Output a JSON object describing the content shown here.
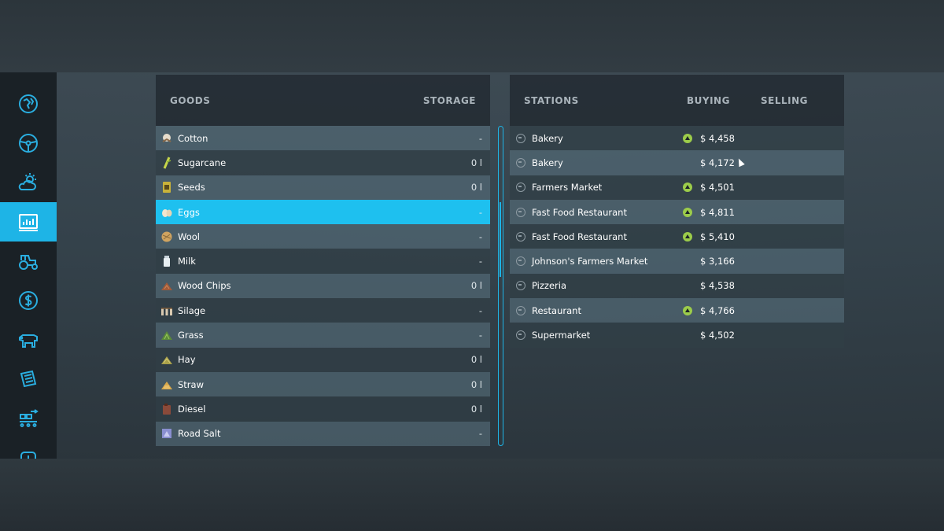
{
  "sidebar": {
    "items": [
      {
        "name": "map-icon",
        "active": false
      },
      {
        "name": "steering-wheel-icon",
        "active": false
      },
      {
        "name": "weather-icon",
        "active": false
      },
      {
        "name": "prices-chart-icon",
        "active": true
      },
      {
        "name": "tractor-icon",
        "active": false
      },
      {
        "name": "dollar-icon",
        "active": false
      },
      {
        "name": "cow-icon",
        "active": false
      },
      {
        "name": "contracts-icon",
        "active": false
      },
      {
        "name": "production-icon",
        "active": false
      },
      {
        "name": "help-icon",
        "active": false
      }
    ]
  },
  "goods": {
    "header_goods": "GOODS",
    "header_storage": "STORAGE",
    "items": [
      {
        "label": "Cotton",
        "value": "-",
        "icon": "cotton-icon"
      },
      {
        "label": "Sugarcane",
        "value": "0 l",
        "icon": "sugarcane-icon"
      },
      {
        "label": "Seeds",
        "value": "0 l",
        "icon": "seeds-icon"
      },
      {
        "label": "Eggs",
        "value": "-",
        "icon": "eggs-icon"
      },
      {
        "label": "Wool",
        "value": "-",
        "icon": "wool-icon"
      },
      {
        "label": "Milk",
        "value": "-",
        "icon": "milk-icon"
      },
      {
        "label": "Wood Chips",
        "value": "0 l",
        "icon": "wood-chips-icon"
      },
      {
        "label": "Silage",
        "value": "-",
        "icon": "silage-icon"
      },
      {
        "label": "Grass",
        "value": "-",
        "icon": "grass-icon"
      },
      {
        "label": "Hay",
        "value": "0 l",
        "icon": "hay-icon"
      },
      {
        "label": "Straw",
        "value": "0 l",
        "icon": "straw-icon"
      },
      {
        "label": "Diesel",
        "value": "0 l",
        "icon": "diesel-icon"
      },
      {
        "label": "Road Salt",
        "value": "-",
        "icon": "road-salt-icon"
      }
    ],
    "selected_index": 3
  },
  "stations": {
    "header_stations": "STATIONS",
    "header_buying": "BUYING",
    "header_selling": "SELLING",
    "items": [
      {
        "name": "Bakery",
        "buying": "$ 4,458",
        "trend_up": true
      },
      {
        "name": "Bakery",
        "buying": "$ 4,172",
        "trend_up": false
      },
      {
        "name": "Farmers Market",
        "buying": "$ 4,501",
        "trend_up": true
      },
      {
        "name": "Fast Food Restaurant",
        "buying": "$ 4,811",
        "trend_up": true
      },
      {
        "name": "Fast Food Restaurant",
        "buying": "$ 5,410",
        "trend_up": true
      },
      {
        "name": "Johnson's Farmers Market",
        "buying": "$ 3,166",
        "trend_up": false
      },
      {
        "name": "Pizzeria",
        "buying": "$ 4,538",
        "trend_up": false
      },
      {
        "name": "Restaurant",
        "buying": "$ 4,766",
        "trend_up": true
      },
      {
        "name": "Supermarket",
        "buying": "$ 4,502",
        "trend_up": false
      }
    ]
  },
  "colors": {
    "accent": "#1ec0ef",
    "trend_up": "#9ccc4a",
    "sidebar_bg": "#1a2126"
  }
}
